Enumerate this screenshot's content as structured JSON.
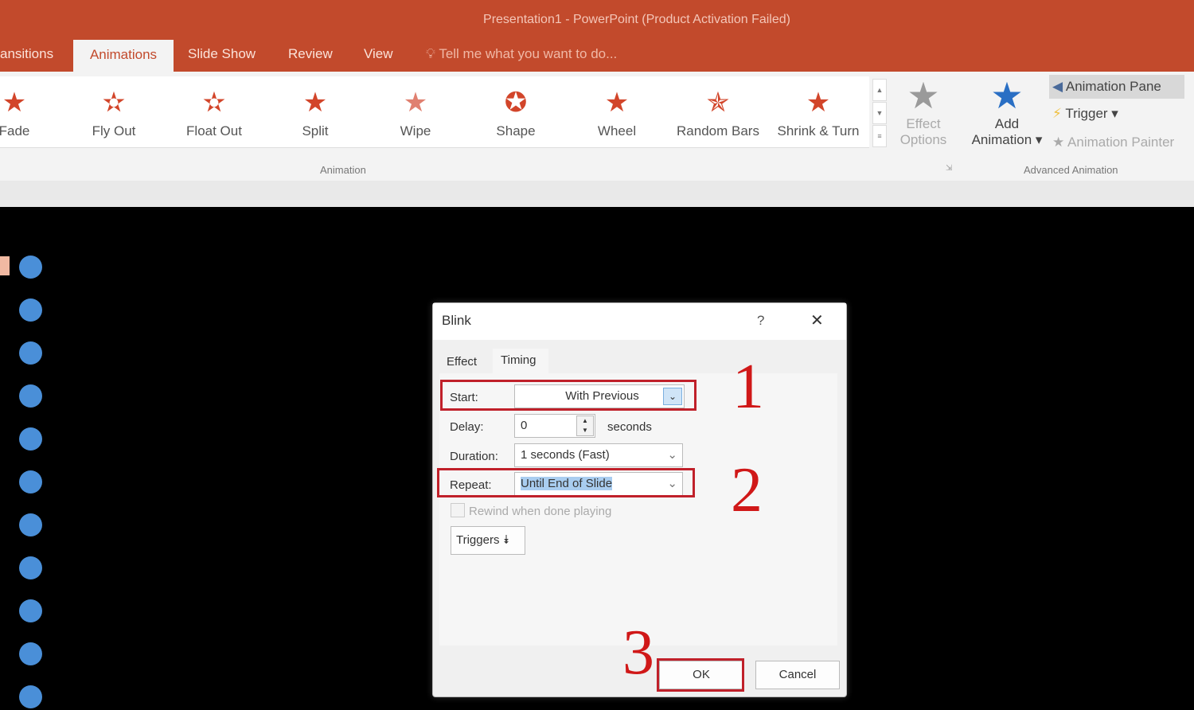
{
  "window": {
    "title": "Presentation1 - PowerPoint (Product Activation Failed)"
  },
  "tabs": [
    {
      "label": "ansitions"
    },
    {
      "label": "Animations"
    },
    {
      "label": "Slide Show"
    },
    {
      "label": "Review"
    },
    {
      "label": "View"
    }
  ],
  "tell_me": "Tell me what you want to do...",
  "gallery": [
    {
      "label": "Fade"
    },
    {
      "label": "Fly Out"
    },
    {
      "label": "Float Out"
    },
    {
      "label": "Split"
    },
    {
      "label": "Wipe"
    },
    {
      "label": "Shape"
    },
    {
      "label": "Wheel"
    },
    {
      "label": "Random Bars"
    },
    {
      "label": "Shrink & Turn"
    }
  ],
  "ribbon": {
    "effect_options_1": "Effect",
    "effect_options_2": "Options",
    "group_animation": "Animation",
    "add_animation_1": "Add",
    "add_animation_2": "Animation",
    "animation_pane": "Animation Pane",
    "trigger": "Trigger",
    "animation_painter": "Animation Painter",
    "group_advanced": "Advanced Animation"
  },
  "dialog": {
    "title": "Blink",
    "help": "?",
    "close": "✕",
    "tabs": [
      "Effect",
      "Timing"
    ],
    "start_label": "Start:",
    "start_value": "With Previous",
    "delay_label": "Delay:",
    "delay_value": "0",
    "delay_unit": "seconds",
    "duration_label": "Duration:",
    "duration_value": "1 seconds (Fast)",
    "repeat_label": "Repeat:",
    "repeat_value": "Until End of Slide",
    "rewind_label": "Rewind when done playing",
    "rewind_checked": false,
    "triggers_label": "Triggers",
    "ok": "OK",
    "cancel": "Cancel"
  },
  "annotations": [
    "1",
    "2",
    "3"
  ],
  "colors": {
    "accent": "#c24a2c",
    "annotation": "#d01818",
    "slide_dot": "#4a8fd8"
  }
}
